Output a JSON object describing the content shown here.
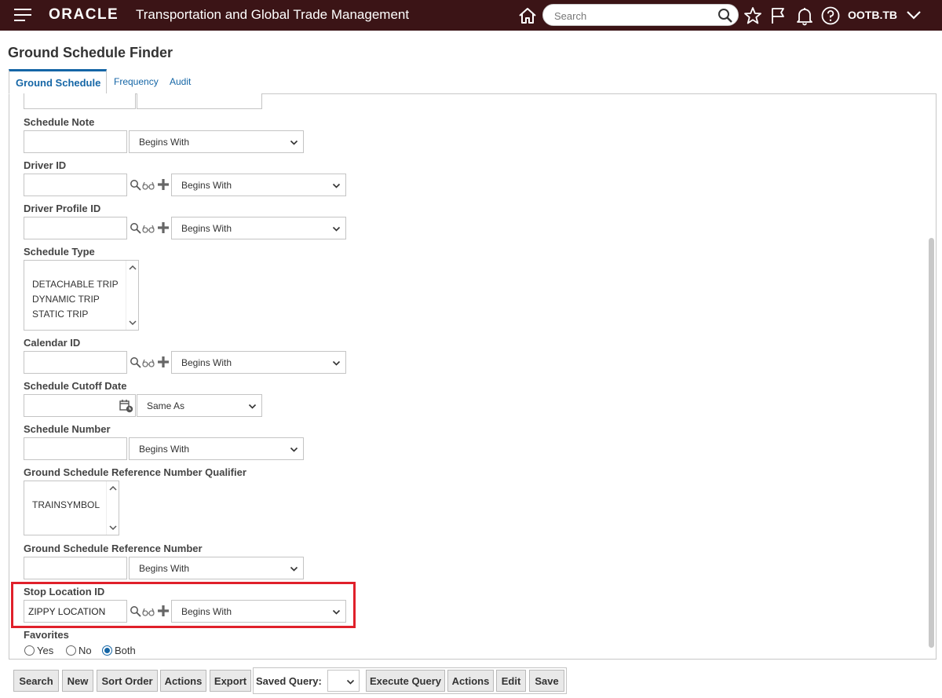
{
  "app": {
    "brand": "ORACLE",
    "title": "Transportation and Global Trade Management",
    "search_placeholder": "Search",
    "user": "OOTB.TB",
    "icons": [
      "menu-icon",
      "home-icon",
      "search-icon",
      "favorites-star-icon",
      "flag-icon",
      "notifications-bell-icon",
      "help-icon",
      "chevron-down-icon"
    ]
  },
  "page": {
    "title": "Ground Schedule Finder",
    "tabs": [
      {
        "label": "Ground Schedule",
        "active": true
      },
      {
        "label": "Frequency",
        "active": false
      },
      {
        "label": "Audit",
        "active": false
      }
    ]
  },
  "form": {
    "partial_top": {
      "operator": "Same As"
    },
    "schedule_note": {
      "label": "Schedule Note",
      "value": "",
      "operator": "Begins With"
    },
    "driver_id": {
      "label": "Driver ID",
      "value": "",
      "operator": "Begins With"
    },
    "driver_profile_id": {
      "label": "Driver Profile ID",
      "value": "",
      "operator": "Begins With"
    },
    "schedule_type": {
      "label": "Schedule Type",
      "options": [
        "DETACHABLE TRIP",
        "DYNAMIC TRIP",
        "STATIC TRIP"
      ]
    },
    "calendar_id": {
      "label": "Calendar ID",
      "value": "",
      "operator": "Begins With"
    },
    "schedule_cutoff_date": {
      "label": "Schedule Cutoff Date",
      "value": "",
      "operator": "Same As"
    },
    "schedule_number": {
      "label": "Schedule Number",
      "value": "",
      "operator": "Begins With"
    },
    "ref_qualifier": {
      "label": "Ground Schedule Reference Number Qualifier",
      "options": [
        "TRAINSYMBOL"
      ]
    },
    "ref_number": {
      "label": "Ground Schedule Reference Number",
      "value": "",
      "operator": "Begins With"
    },
    "stop_location_id": {
      "label": "Stop Location ID",
      "value": "ZIPPY LOCATION",
      "operator": "Begins With"
    },
    "favorites": {
      "label": "Favorites",
      "options": [
        {
          "label": "Yes",
          "selected": false
        },
        {
          "label": "No",
          "selected": false
        },
        {
          "label": "Both",
          "selected": true
        }
      ]
    }
  },
  "buttons": {
    "search": "Search",
    "new": "New",
    "sort_order": "Sort Order",
    "actions": "Actions",
    "export": "Export",
    "saved_query_label": "Saved Query:",
    "saved_query_value": "",
    "execute_query": "Execute Query",
    "actions2": "Actions",
    "edit": "Edit",
    "save": "Save"
  },
  "colors": {
    "topbar": "#3b1416",
    "link": "#1566a6",
    "highlight": "#e0202a"
  }
}
